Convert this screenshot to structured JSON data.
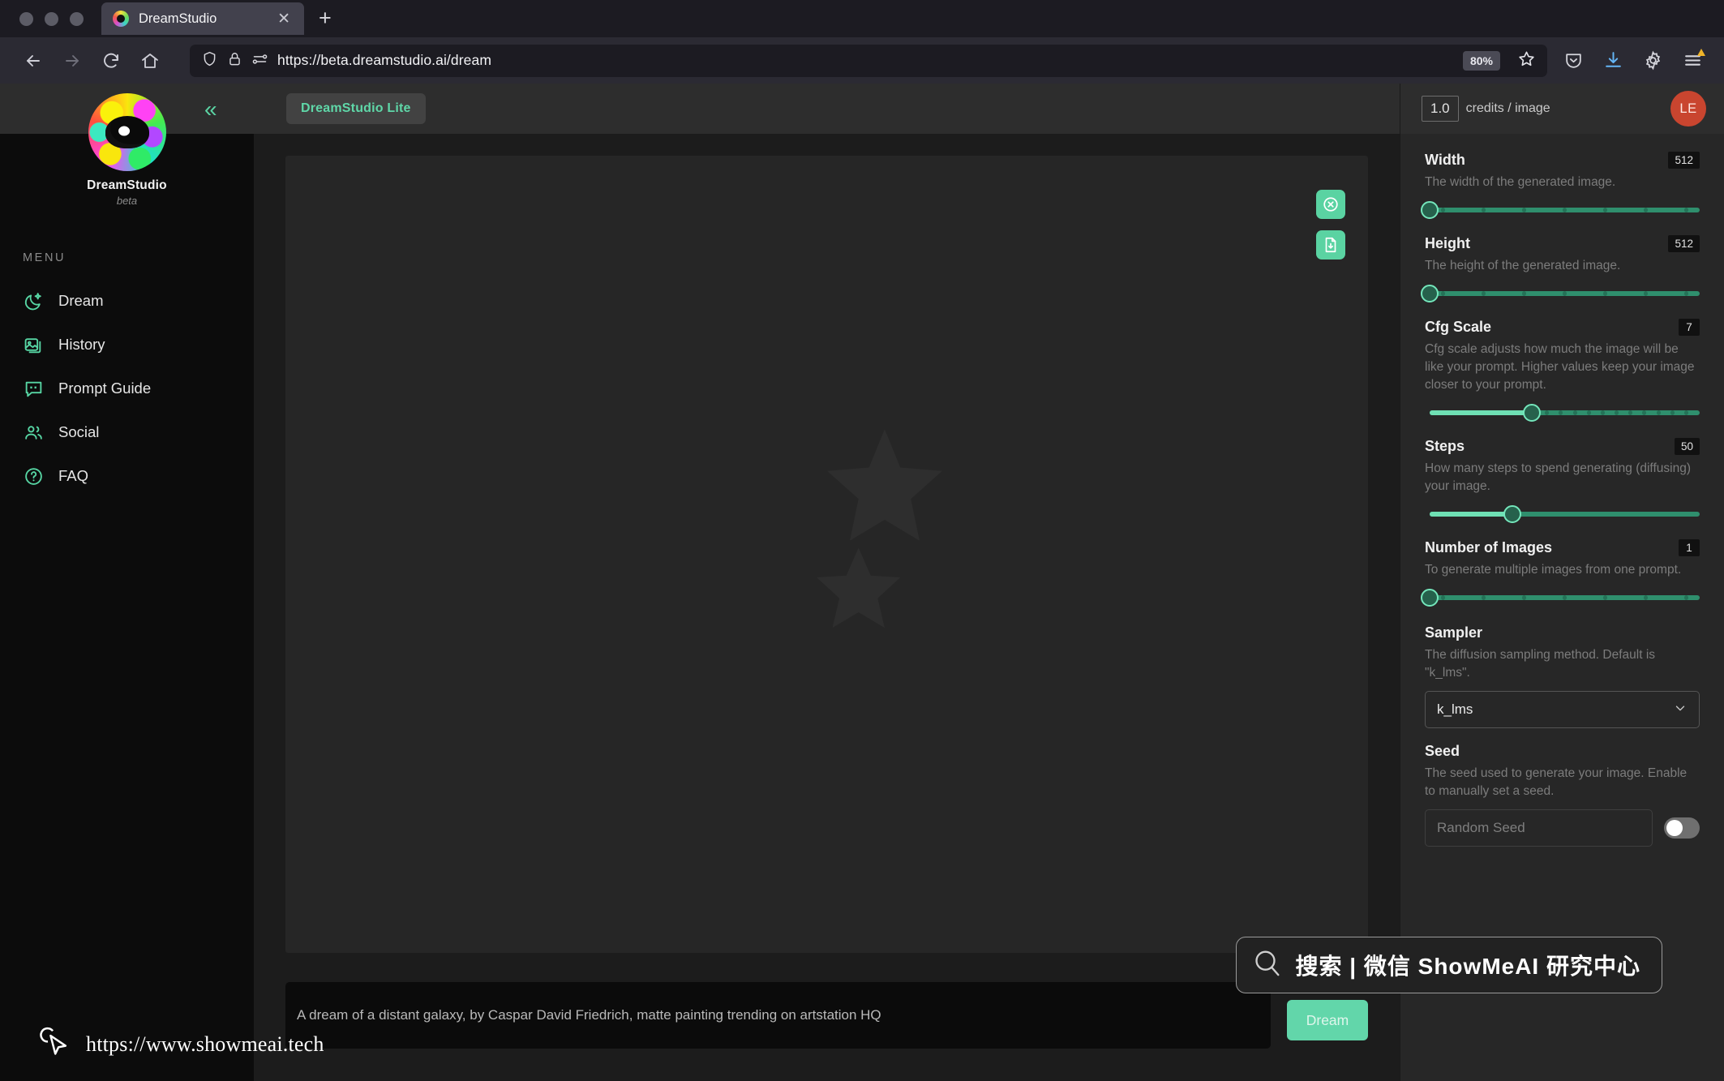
{
  "browser": {
    "tab": {
      "title": "DreamStudio",
      "favicon": "dreamstudio-favicon",
      "close": "✕"
    },
    "newtab_label": "+",
    "nav": {
      "back": "←",
      "forward": "→",
      "reload": "↻",
      "home": "⌂"
    },
    "url": "https://beta.dreamstudio.ai/dream",
    "zoom_level": "80%",
    "icons": [
      "shield-icon",
      "lock-icon",
      "permissions-icon",
      "bookmark-star-icon",
      "pocket-icon",
      "downloads-icon",
      "settings-gear-icon",
      "app-menu-icon"
    ]
  },
  "sidebar": {
    "logo_name": "DreamStudio",
    "logo_sub": "beta",
    "collapse": "«",
    "menu_label": "MENU",
    "items": [
      {
        "label": "Dream",
        "icon": "moon-sparkle-icon"
      },
      {
        "label": "History",
        "icon": "images-stack-icon"
      },
      {
        "label": "Prompt Guide",
        "icon": "quote-bubble-icon"
      },
      {
        "label": "Social",
        "icon": "people-icon"
      },
      {
        "label": "FAQ",
        "icon": "question-circle-icon"
      }
    ]
  },
  "main": {
    "lite_pill": "DreamStudio Lite",
    "canvas_placeholder_icon": "crescent-moon-stars-icon",
    "actions": [
      {
        "name": "clear-canvas-button",
        "icon": "x-circle-icon"
      },
      {
        "name": "download-button",
        "icon": "file-download-icon"
      }
    ],
    "prompt_value": "A dream of a distant galaxy, by Caspar David Friedrich, matte painting trending on artstation HQ",
    "dream_button": "Dream"
  },
  "settings": {
    "credits_value": "1.0",
    "credits_label": "credits / image",
    "avatar_initials": "LE",
    "fields": [
      {
        "title": "Width",
        "value": "512",
        "desc": "The width of the generated image.",
        "fill_pct": 0,
        "ticks": 8
      },
      {
        "title": "Height",
        "value": "512",
        "desc": "The height of the generated image.",
        "fill_pct": 0,
        "ticks": 8
      },
      {
        "title": "Cfg Scale",
        "value": "7",
        "desc": "Cfg scale adjusts how much the image will be like your prompt. Higher values keep your image closer to your prompt.",
        "fill_pct": 35,
        "ticks": 14
      },
      {
        "title": "Steps",
        "value": "50",
        "desc": "How many steps to spend generating (diffusing) your image.",
        "fill_pct": 28,
        "ticks": 0
      },
      {
        "title": "Number of Images",
        "value": "1",
        "desc": "To generate multiple images from one prompt.",
        "fill_pct": 0,
        "ticks": 8
      }
    ],
    "sampler": {
      "title": "Sampler",
      "desc": "The diffusion sampling method. Default is \"k_lms\".",
      "selected": "k_lms",
      "chevron": "⌄"
    },
    "seed": {
      "title": "Seed",
      "desc": "The seed used to generate your image. Enable to manually set a seed.",
      "placeholder": "Random Seed",
      "toggle_on": false
    }
  },
  "watermarks": {
    "left_url": "https://www.showmeai.tech",
    "right_text": "搜索 | 微信 ShowMeAI 研究中心"
  },
  "colors": {
    "accent_mint": "#5fd7a8",
    "slider_fill": "#6fe0b4",
    "slider_track": "#2f8f6d",
    "avatar_red": "#c9452f",
    "panel_bg": "#272727",
    "canvas_bg": "#262626"
  }
}
